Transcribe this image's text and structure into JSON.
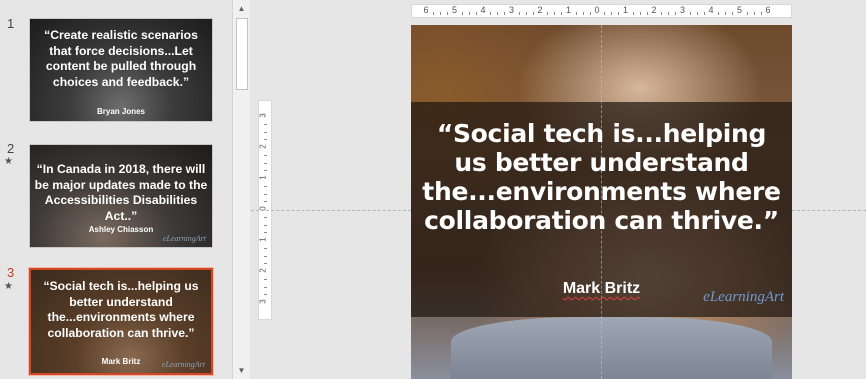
{
  "thumbnails": [
    {
      "number": "1",
      "quote": "“Create realistic scenarios that force decisions...Let content be pulled through choices and feedback.”",
      "author": "Bryan Jones",
      "logo": "",
      "has_transition_star": false
    },
    {
      "number": "2",
      "quote": "“In Canada in 2018, there will be major updates made to the Accessibilities Disabilities Act..”",
      "author": "Ashley Chiasson",
      "logo": "eLearningArt",
      "has_transition_star": true
    },
    {
      "number": "3",
      "quote": "“Social tech is...helping us better understand the...environments where collaboration can thrive.”",
      "author": "Mark Britz",
      "logo": "eLearningArt",
      "has_transition_star": true
    }
  ],
  "selected_slide": "3",
  "star_glyph": "★",
  "scrollbar": {
    "up_arrow": "▲",
    "down_arrow": "▼"
  },
  "ruler": {
    "horizontal_labels": [
      "6",
      "5",
      "4",
      "3",
      "2",
      "1",
      "0",
      "1",
      "2",
      "3",
      "4",
      "5",
      "6"
    ],
    "vertical_labels": [
      "3",
      "2",
      "1",
      "0",
      "1",
      "2",
      "3"
    ]
  },
  "main_slide": {
    "quote": "“Social tech is...helping us better understand the...environments where collaboration can thrive.”",
    "author": "Mark Britz",
    "logo": "eLearningArt"
  },
  "colors": {
    "selected_border": "#d24726",
    "active_number": "#c43e1c",
    "logo_blue": "#6f9bd0"
  }
}
